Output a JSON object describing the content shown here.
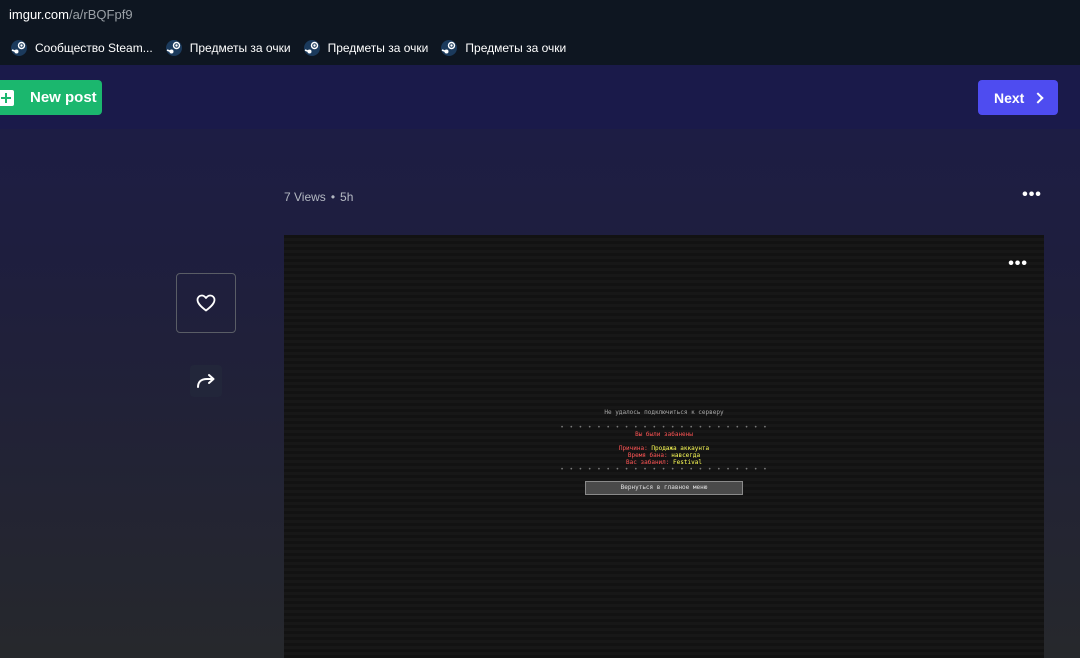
{
  "browser": {
    "url_host": "imgur.com",
    "url_path": "/a/rBQFpf9",
    "bookmarks": [
      {
        "label": "Сообщество Steam...",
        "icon": "steam-icon"
      },
      {
        "label": "Предметы за очки",
        "icon": "steam-icon"
      },
      {
        "label": "Предметы за очки",
        "icon": "steam-icon"
      },
      {
        "label": "Предметы за очки",
        "icon": "steam-icon"
      }
    ]
  },
  "header": {
    "new_post_label": "New post",
    "next_label": "Next"
  },
  "post": {
    "views": "7 Views",
    "separator": "•",
    "age": "5h",
    "more_label": "•••"
  },
  "screenshot": {
    "title": "Не удалось подключиться к серверу",
    "separator": "• • • • • • • • • • • • • • • • • • • • • • •",
    "banned": "Вы были забанены",
    "reason_label": "Причина:",
    "reason_value": "Продажа аккаунта",
    "time_label": "Время бана:",
    "time_value": "навсегда",
    "by_label": "Вас забанил:",
    "by_value": "Festival",
    "button_label": "Вернуться в главное меню"
  },
  "colors": {
    "accent_green": "#1bb76e",
    "accent_blue": "#4e4cf0",
    "header_bg": "#1a1a4a"
  }
}
